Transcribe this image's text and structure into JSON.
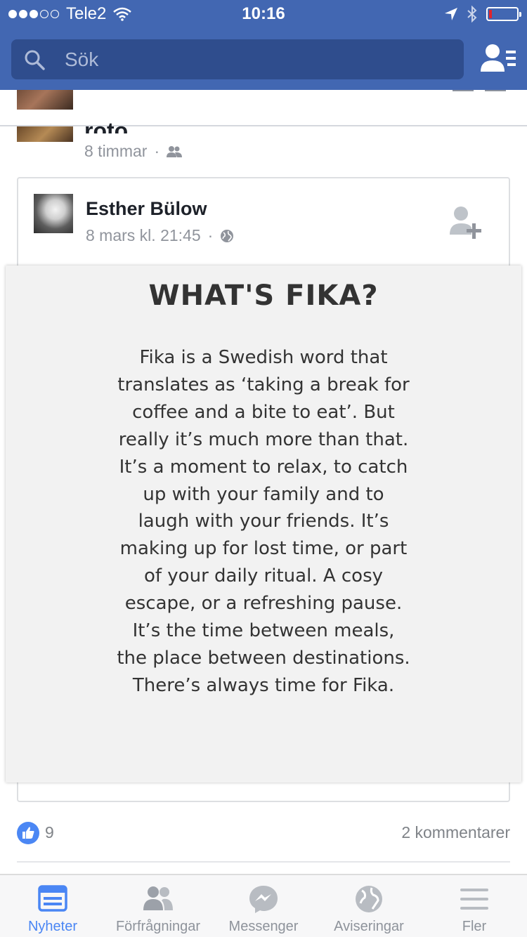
{
  "status_bar": {
    "carrier": "Tele2",
    "time": "10:16"
  },
  "search": {
    "placeholder": "Sök"
  },
  "previous_post": {
    "title_fragment": "roto.",
    "timestamp": "8 timmar"
  },
  "post": {
    "author": "Esther Bülow",
    "timestamp": "8 mars kl. 21:45",
    "image": {
      "title": "WHAT'S FIKA?",
      "body": "Fika is a Swedish word that translates as ‘taking a break for coffee and a bite to eat’. But really it’s much more than that. It’s a moment to relax, to catch up with your family and to laugh with your friends. It’s making up for lost time, or part of your daily ritual. A cosy escape, or a refreshing pause. It’s the time between meals, the place between destinations. There’s always time for Fika."
    },
    "likes": "9",
    "comments": "2 kommentarer"
  },
  "tabs": [
    {
      "label": "Nyheter",
      "icon": "news-feed-icon",
      "active": true
    },
    {
      "label": "Förfrågningar",
      "icon": "friend-requests-icon",
      "active": false
    },
    {
      "label": "Messenger",
      "icon": "messenger-icon",
      "active": false
    },
    {
      "label": "Aviseringar",
      "icon": "globe-notifications-icon",
      "active": false
    },
    {
      "label": "Fler",
      "icon": "menu-icon",
      "active": false
    }
  ],
  "colors": {
    "header": "#4267b2",
    "search_bg": "#2f4d8d",
    "active_tab": "#4a86f4",
    "like": "#4b87f4",
    "meta_text": "#90949c"
  }
}
